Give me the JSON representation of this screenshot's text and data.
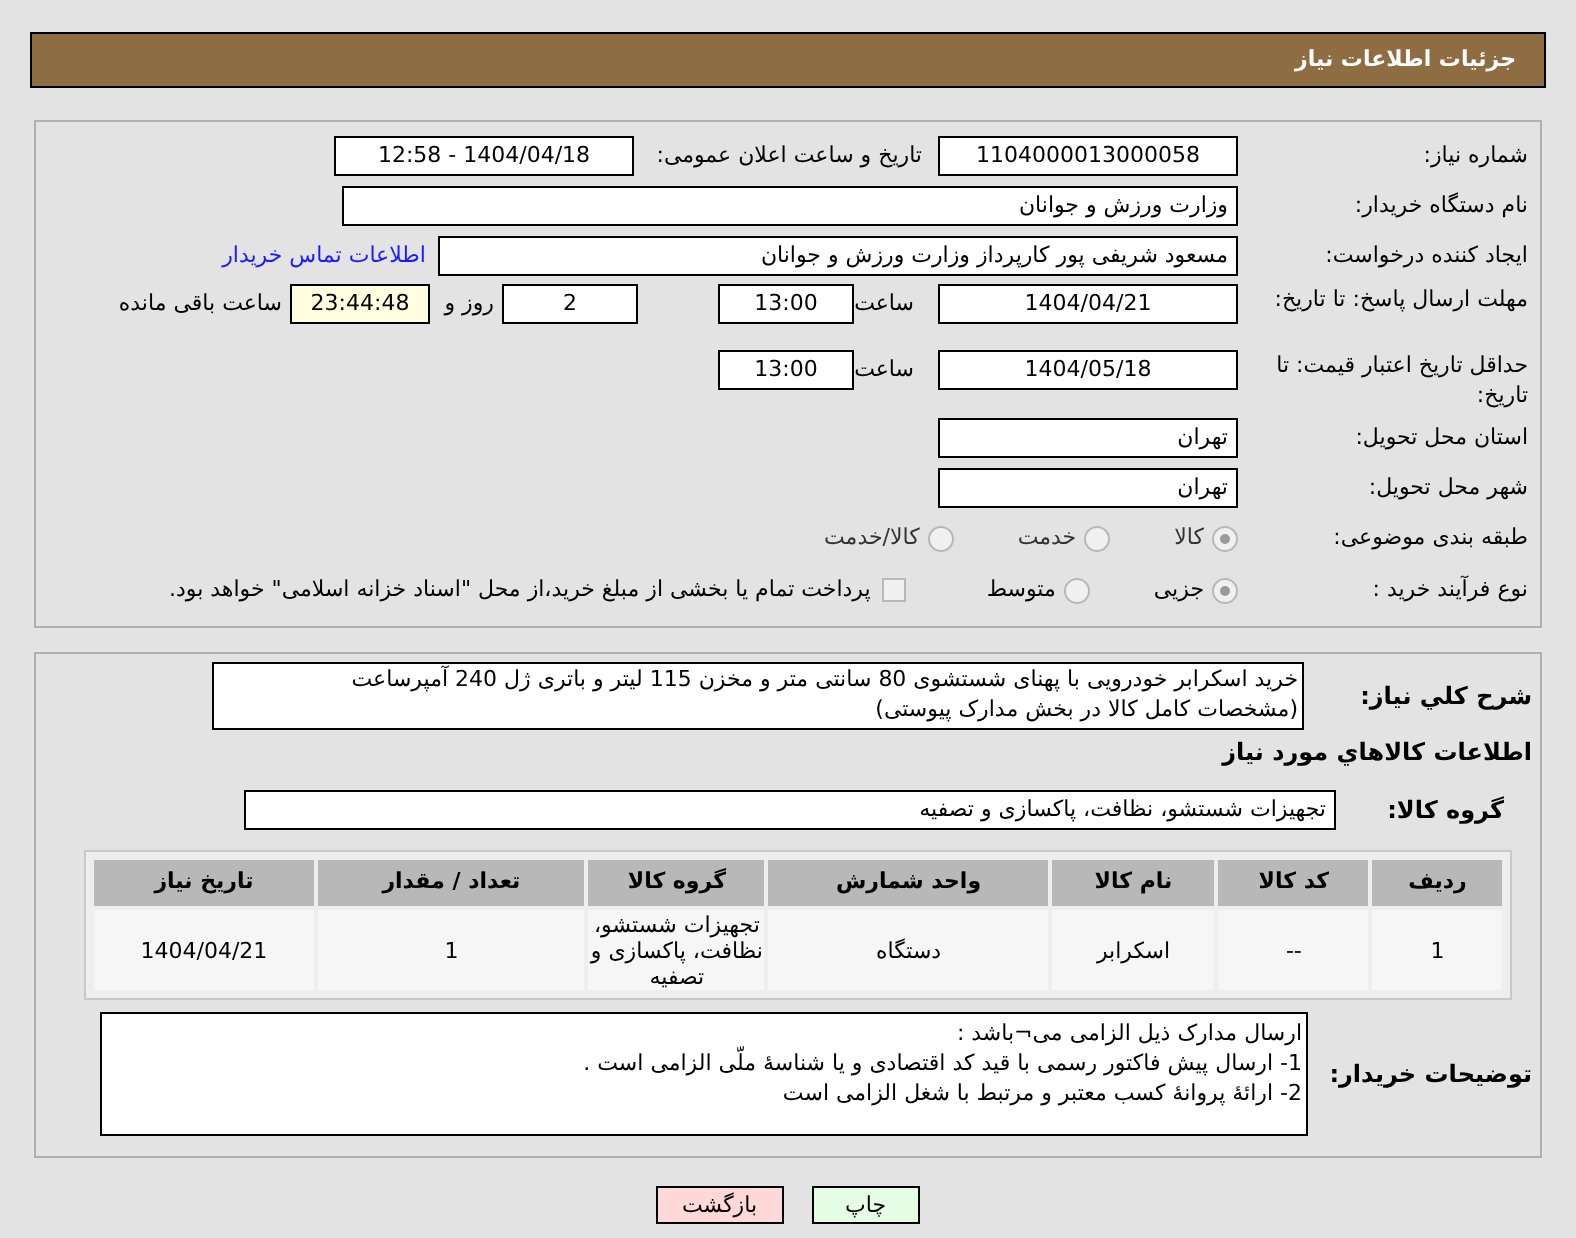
{
  "header": {
    "title": "جزئیات اطلاعات نیاز"
  },
  "need_number": {
    "label": "شماره نیاز:",
    "value": "1104000013000058"
  },
  "announce": {
    "label": "تاریخ و ساعت اعلان عمومی:",
    "value": "1404/04/18 - 12:58"
  },
  "buyer_org": {
    "label": "نام دستگاه خریدار:",
    "value": "وزارت ورزش و جوانان"
  },
  "requester": {
    "label": "ایجاد کننده درخواست:",
    "value": "مسعود شریفی پور کارپرداز وزارت ورزش و جوانان",
    "link": "اطلاعات تماس خریدار"
  },
  "deadline": {
    "label": "مهلت ارسال پاسخ: تا تاریخ:",
    "date": "1404/04/21",
    "time_label": "ساعت",
    "time": "13:00",
    "days": "2",
    "days_label": "روز و",
    "remaining": "23:44:48",
    "remaining_label": "ساعت باقی مانده"
  },
  "validity": {
    "label": "حداقل تاریخ اعتبار قیمت: تا تاریخ:",
    "date": "1404/05/18",
    "time_label": "ساعت",
    "time": "13:00"
  },
  "province": {
    "label": "استان محل تحویل:",
    "value": "تهران"
  },
  "city": {
    "label": "شهر محل تحویل:",
    "value": "تهران"
  },
  "category": {
    "label": "طبقه بندی موضوعی:",
    "options": [
      {
        "label": "کالا",
        "selected": true
      },
      {
        "label": "خدمت",
        "selected": false
      },
      {
        "label": "کالا/خدمت",
        "selected": false
      }
    ]
  },
  "process": {
    "label": "نوع فرآیند خرید :",
    "options": [
      {
        "label": "جزیی",
        "selected": true
      },
      {
        "label": "متوسط",
        "selected": false
      }
    ],
    "treasury": {
      "label": "پرداخت تمام یا بخشی از مبلغ خرید،از محل \"اسناد خزانه اسلامی\" خواهد بود.",
      "checked": false
    }
  },
  "description": {
    "label": "شرح کلي نیاز:",
    "lines": [
      "خرید اسکرابر خودرویی با پهنای شستشوی 80 سانتی متر و مخزن 115 لیتر و باتری ژل 240 آمپرساعت",
      "(مشخصات کامل کالا در بخش مدارک پیوستی)"
    ]
  },
  "goods_heading": "اطلاعات کالاهاي مورد نیاز",
  "goods_group": {
    "label": "گروه کالا:",
    "value": "تجهیزات شستشو، نظافت، پاکسازی و تصفیه"
  },
  "table": {
    "columns": [
      "ردیف",
      "کد کالا",
      "نام کالا",
      "واحد شمارش",
      "گروه کالا",
      "تعداد / مقدار",
      "تاریخ نیاز"
    ],
    "rows": [
      [
        "1",
        "--",
        "اسکرابر",
        "دستگاه",
        "تجهیزات شستشو، نظافت، پاکسازی و تصفیه",
        "1",
        "1404/04/21"
      ]
    ]
  },
  "buyer_notes": {
    "label": "توضیحات خریدار:",
    "lines": [
      "ارسال مدارک ذیل الزامی می¬باشد :",
      "1- ارسال پیش فاکتور رسمی با قید کد اقتصادی و یا شناسۀ ملّی الزامی است .",
      "2- ارائۀ پروانۀ کسب معتبر و مرتبط با شغل الزامی است"
    ]
  },
  "buttons": [
    {
      "label": "چاپ",
      "kind": "print"
    },
    {
      "label": "بازگشت",
      "kind": "back"
    }
  ]
}
